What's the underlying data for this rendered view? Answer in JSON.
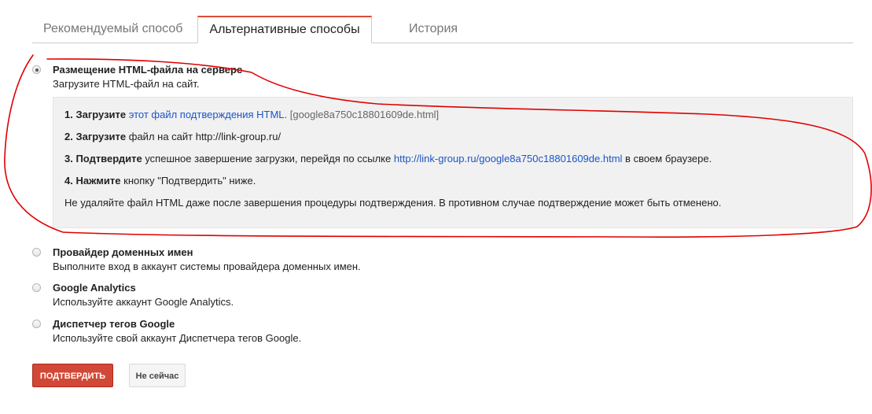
{
  "tabs": [
    {
      "label": "Рекомендуемый способ"
    },
    {
      "label": "Альтернативные способы"
    },
    {
      "label": "История"
    }
  ],
  "methods": [
    {
      "title": "Размещение HTML-файла на сервере",
      "description": "Загрузите HTML-файл на сайт.",
      "selected": true
    },
    {
      "title": "Провайдер доменных имен",
      "description": "Выполните вход в аккаунт системы провайдера доменных имен.",
      "selected": false
    },
    {
      "title": "Google Analytics",
      "description": "Используйте аккаунт Google Analytics.",
      "selected": false
    },
    {
      "title": "Диспетчер тегов Google",
      "description": "Используйте свой аккаунт Диспетчера тегов Google.",
      "selected": false
    }
  ],
  "instructions": {
    "step1": {
      "bold": "1. Загрузите",
      "link": "этот файл подтверждения HTML.",
      "file": "[google8a750c18801609de.html]"
    },
    "step2": {
      "bold": "2. Загрузите",
      "text": "файл на сайт http://link-group.ru/"
    },
    "step3": {
      "bold": "3. Подтвердите",
      "text": "успешное завершение загрузки, перейдя по ссылке",
      "link": "http://link-group.ru/google8a750c18801609de.html",
      "after": "в своем браузере."
    },
    "step4": {
      "bold": "4. Нажмите",
      "text": "кнопку \"Подтвердить\" ниже."
    },
    "note": "Не удаляйте файл HTML даже после завершения процедуры подтверждения. В противном случае подтверждение может быть отменено."
  },
  "buttons": {
    "confirm": "ПОДТВЕРДИТЬ",
    "later": "Не сейчас"
  },
  "colors": {
    "accent": "#dd4b39",
    "primary_button": "#d14836",
    "link": "#1a55c8",
    "annotation": "#e00000"
  }
}
